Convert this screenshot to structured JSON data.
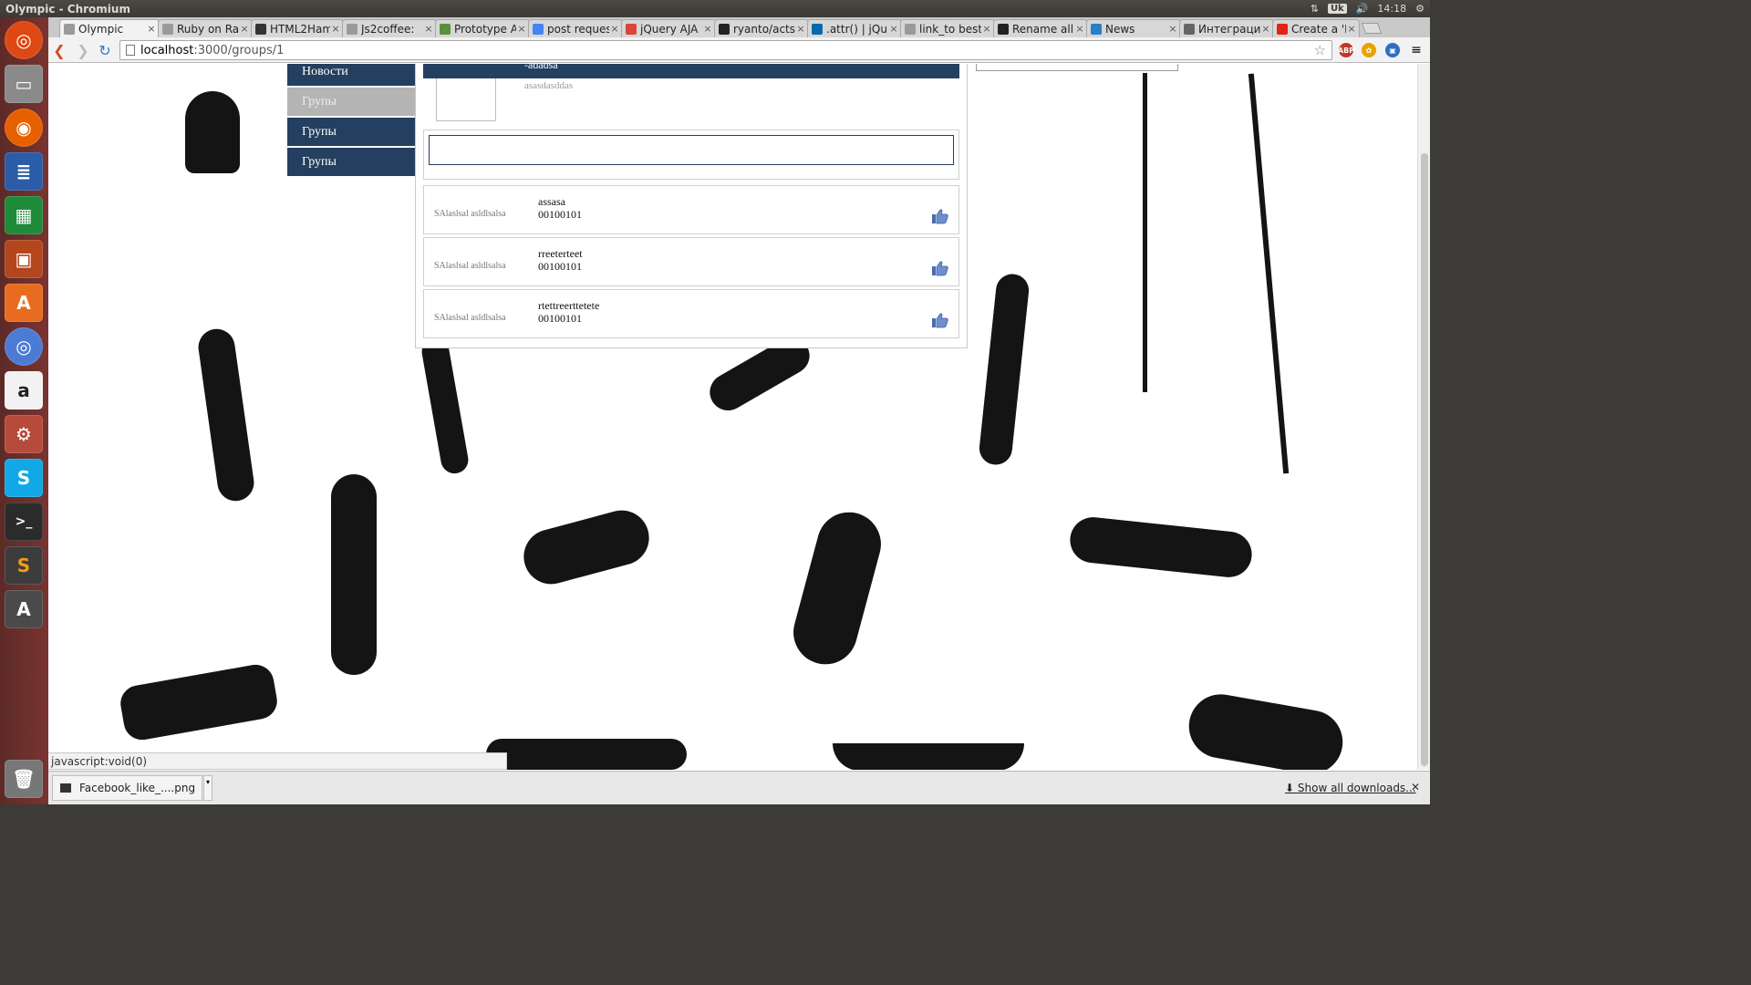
{
  "os": {
    "window_title": "Olympic - Chromium",
    "keyboard_layout": "Uk",
    "clock": "14:18"
  },
  "browser": {
    "tabs": [
      {
        "label": "Olympic",
        "icon": "page-icon",
        "active": true
      },
      {
        "label": "Ruby on Rai",
        "icon": "page-icon"
      },
      {
        "label": "HTML2Ham",
        "icon": "octocat-icon"
      },
      {
        "label": "Js2coffee: ",
        "icon": "page-icon"
      },
      {
        "label": "Prototype A",
        "icon": "prototype-icon"
      },
      {
        "label": "post reques",
        "icon": "google-icon"
      },
      {
        "label": "jQuery AJA",
        "icon": "chrome-icon"
      },
      {
        "label": "ryanto/acts",
        "icon": "github-icon"
      },
      {
        "label": ".attr() | jQu",
        "icon": "jquery-icon"
      },
      {
        "label": "link_to best",
        "icon": "page-icon"
      },
      {
        "label": "Rename all",
        "icon": "github-icon"
      },
      {
        "label": "News",
        "icon": "trello-icon"
      },
      {
        "label": "Интеграци",
        "icon": "gear-icon"
      },
      {
        "label": "Create a 'Li",
        "icon": "youtube-icon"
      }
    ],
    "url_host": "localhost",
    "url_path": ":3000/groups/1",
    "status_text": "javascript:void(0)",
    "download_filename": "Facebook_like_....png",
    "show_all_downloads": "Show all downloads..."
  },
  "page": {
    "menu": [
      {
        "label": "Новости"
      },
      {
        "label": "Групы"
      },
      {
        "label": "Групы"
      },
      {
        "label": "Групы"
      }
    ],
    "group": {
      "name": "-adadsa",
      "description": "asasdasddas"
    },
    "comment_input": {
      "value": "",
      "placeholder": ""
    },
    "posts": [
      {
        "author": "SAlaslsal asldlsalsa",
        "text": "assasa",
        "code": "00100101"
      },
      {
        "author": "SAlaslsal asldlsalsa",
        "text": "rreeterteet",
        "code": "00100101"
      },
      {
        "author": "SAlaslsal asldlsalsa",
        "text": "rtettreerttetete",
        "code": "00100101"
      }
    ]
  },
  "colors": {
    "navy": "#243f5f",
    "menu_hover": "#b4b4b4",
    "launcher": "#7a3430",
    "like_blue": "#5a7abf"
  }
}
